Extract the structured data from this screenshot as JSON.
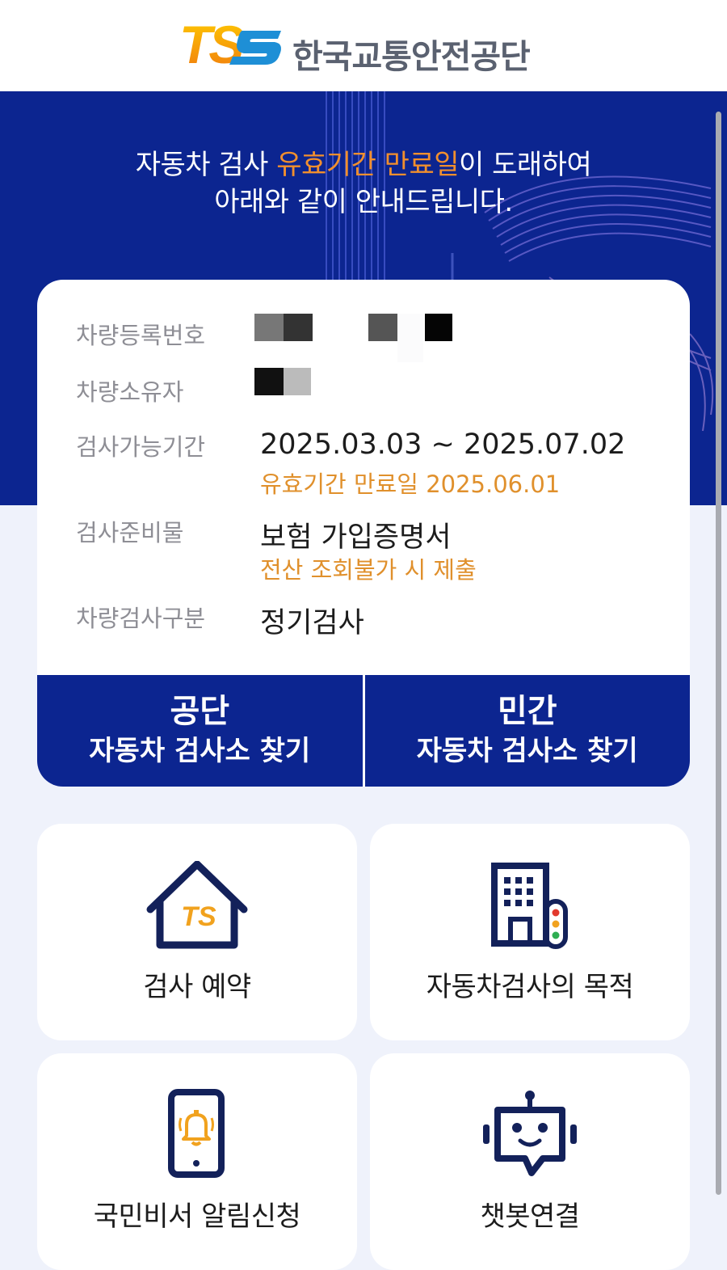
{
  "header": {
    "logo_mark": "TS",
    "org_name": "한국교통안전공단"
  },
  "hero": {
    "line1_pre": "자동차 검사 ",
    "line1_highlight": "유효기간 만료일",
    "line1_post": "이 도래하여",
    "line2": "아래와 같이 안내드립니다."
  },
  "info": {
    "reg_number": {
      "label": "차량등록번호"
    },
    "owner": {
      "label": "차량소유자"
    },
    "period": {
      "label": "검사가능기간",
      "value": "2025.03.03 ~ 2025.07.02",
      "sub": "유효기간 만료일 2025.06.01"
    },
    "prep": {
      "label": "검사준비물",
      "value": "보험 가입증명서",
      "sub": "전산 조회불가 시 제출"
    },
    "type": {
      "label": "차량검사구분",
      "value": "정기검사"
    }
  },
  "buttons": {
    "public": {
      "line1": "공단",
      "line2": "자동차 검사소 찾기"
    },
    "private": {
      "line1": "민간",
      "line2": "자동차 검사소 찾기"
    }
  },
  "tiles": {
    "reserve": {
      "label": "검사 예약",
      "icon": "ts-house-icon",
      "icon_text": "TS"
    },
    "purpose": {
      "label": "자동차검사의 목적",
      "icon": "building-traffic-light-icon"
    },
    "notify": {
      "label": "국민비서 알림신청",
      "icon": "phone-bell-icon"
    },
    "chatbot": {
      "label": "챗봇연결",
      "icon": "robot-icon"
    }
  },
  "colors": {
    "brand_navy": "#0c2590",
    "accent_orange": "#f18f2e",
    "page_bg": "#eff2fb"
  }
}
